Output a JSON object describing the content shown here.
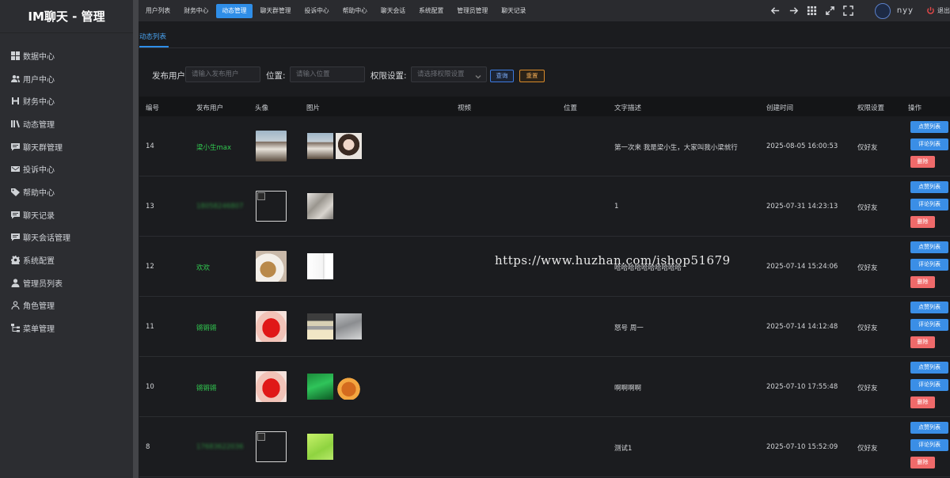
{
  "app": {
    "title": "IM聊天 - 管理"
  },
  "sidebar": {
    "items": [
      {
        "label": "数据中心",
        "icon": "grid-icon"
      },
      {
        "label": "用户中心",
        "icon": "users-icon"
      },
      {
        "label": "财务中心",
        "icon": "finance-icon"
      },
      {
        "label": "动态管理",
        "icon": "library-icon"
      },
      {
        "label": "聊天群管理",
        "icon": "chat-icon"
      },
      {
        "label": "投诉中心",
        "icon": "mail-icon"
      },
      {
        "label": "帮助中心",
        "icon": "tag-icon"
      },
      {
        "label": "聊天记录",
        "icon": "chat-icon"
      },
      {
        "label": "聊天会话管理",
        "icon": "chat-icon"
      },
      {
        "label": "系统配置",
        "icon": "gear-icon"
      },
      {
        "label": "管理员列表",
        "icon": "user-icon"
      },
      {
        "label": "角色管理",
        "icon": "user-outline-icon"
      },
      {
        "label": "菜单管理",
        "icon": "tree-icon"
      }
    ]
  },
  "topnav": {
    "tabs": [
      "用户列表",
      "财务中心",
      "动态管理",
      "聊天群管理",
      "投诉中心",
      "帮助中心",
      "聊天会话",
      "系统配置",
      "管理员管理",
      "聊天记录"
    ],
    "active_index": 2
  },
  "header": {
    "username": "nyy",
    "logout_label": "退出"
  },
  "page": {
    "tab_label": "动态列表"
  },
  "filters": {
    "publisher_label": "发布用户",
    "publisher_placeholder": "请输入发布用户",
    "location_label": "位置:",
    "location_placeholder": "请输入位置",
    "permission_label": "权限设置:",
    "permission_placeholder": "请选择权限设置",
    "query_label": "查询",
    "reset_label": "重置"
  },
  "table": {
    "headers": [
      "编号",
      "发布用户",
      "头像",
      "图片",
      "视频",
      "位置",
      "文字描述",
      "创建时间",
      "权限设置",
      "操作"
    ],
    "actions": {
      "likes": "点赞列表",
      "comments": "评论列表",
      "delete": "删除"
    },
    "rows": [
      {
        "id": "14",
        "user": "梁小生max",
        "user_blurred": false,
        "avatar": "photo-man",
        "images": [
          "photo-man",
          "photo-girl"
        ],
        "video": "",
        "location": "",
        "text": "第一次来 我是梁小生，大家叫我小梁就行",
        "created": "2025-08-05 16:00:53",
        "permission": "仅好友"
      },
      {
        "id": "13",
        "user": "18058246807",
        "user_blurred": true,
        "avatar": "broken",
        "images": [
          "photo-hand"
        ],
        "video": "",
        "location": "",
        "text": "1",
        "created": "2025-07-31 14:23:13",
        "permission": "仅好友"
      },
      {
        "id": "12",
        "user": "欢欢",
        "user_blurred": false,
        "avatar": "photo-cat",
        "images": [
          "photo-white"
        ],
        "video": "",
        "location": "",
        "text": "哈哈哈哈哈哈哈哈哈哈",
        "created": "2025-07-14 15:24:06",
        "permission": "仅好友"
      },
      {
        "id": "11",
        "user": "锵锵锵",
        "user_blurred": false,
        "avatar": "photo-lips",
        "images": [
          "photo-screen",
          "photo-grey"
        ],
        "video": "",
        "location": "",
        "text": "怒号 周一",
        "created": "2025-07-14 14:12:48",
        "permission": "仅好友"
      },
      {
        "id": "10",
        "user": "锵锵锵",
        "user_blurred": false,
        "avatar": "photo-lips",
        "images": [
          "photo-green",
          "photo-food"
        ],
        "video": "",
        "location": "",
        "text": "啊啊啊啊",
        "created": "2025-07-10 17:55:48",
        "permission": "仅好友"
      },
      {
        "id": "8",
        "user": "17683622036",
        "user_blurred": true,
        "avatar": "broken",
        "images": [
          "photo-lime"
        ],
        "video": "",
        "location": "",
        "text": "测试1",
        "created": "2025-07-10 15:52:09",
        "permission": "仅好友"
      }
    ]
  },
  "watermark": "https://www.huzhan.com/ishop51679",
  "colors": {
    "accent": "#2f8ee8",
    "sidebar": "#2c2d31",
    "user_green": "#31c950",
    "danger": "#ef6a6a"
  }
}
